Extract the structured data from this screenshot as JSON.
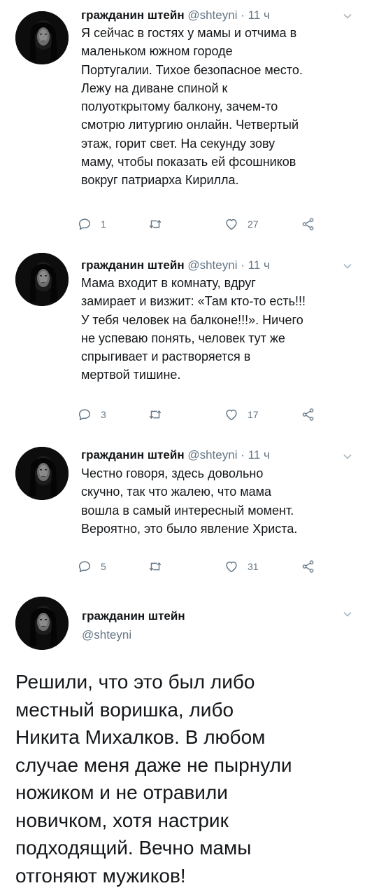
{
  "tweets": [
    {
      "name": "гражданин штейн",
      "handle": "@shteyni",
      "dot": "·",
      "time": "11 ч",
      "text": "Я сейчас в гостях у мамы и отчима в\nмаленьком южном городе\nПортугалии. Тихое безопасное место.\nЛежу на диване спиной к\nполуоткрытому балкону, зачем-то\nсмотрю литургию онлайн. Четвертый\nэтаж, горит свет. На секунду зову\nмаму, чтобы показать ей фсошников\nвокруг патриарха Кирилла.",
      "replies": "1",
      "retweets": "",
      "likes": "27"
    },
    {
      "name": "гражданин штейн",
      "handle": "@shteyni",
      "dot": "·",
      "time": "11 ч",
      "text": "Мама входит в комнату, вдруг\nзамирает и визжит: «Там кто-то есть!!!\nУ тебя человек на балконе!!!». Ничего\nне успеваю понять, человек тут же\nспрыгивает и растворяется в\nмертвой тишине.",
      "replies": "3",
      "retweets": "",
      "likes": "17"
    },
    {
      "name": "гражданин штейн",
      "handle": "@shteyni",
      "dot": "·",
      "time": "11 ч",
      "text": "Честно говоря, здесь довольно\nскучно, так что жалею, что мама\nвошла в самый интересный момент.\nВероятно, это было явление Христа.",
      "replies": "5",
      "retweets": "",
      "likes": "31"
    }
  ],
  "main_tweet": {
    "name": "гражданин штейн",
    "handle": "@shteyni",
    "text": "Решили, что это был либо\nместный воришка, либо\nНикита Михалков. В любом\nслучае меня даже не пырнули\nножиком и не отравили\nновичком, хотя настрик\nподходящий. Вечно мамы\nотгоняют мужиков!"
  },
  "icons": {
    "reply": "reply-icon",
    "retweet": "retweet-icon",
    "like": "heart-icon",
    "share": "share-icon",
    "more": "chevron-down-icon"
  },
  "colors": {
    "text": "#14171a",
    "secondary": "#657786",
    "chevron": "#aab8c2"
  }
}
